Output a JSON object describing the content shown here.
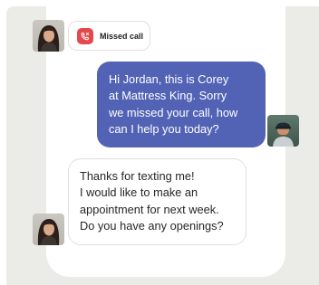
{
  "missed_call": {
    "label": "Missed call",
    "icon": "phone-missed-icon",
    "icon_color": "#e5484d"
  },
  "outgoing_message": {
    "lines": [
      "Hi Jordan, this is Corey",
      "at Mattress King. Sorry",
      "we missed your call, how",
      "can I help you today?"
    ],
    "bubble_color": "#5263b5"
  },
  "incoming_message": {
    "lines": [
      "Thanks for texting me!",
      "I would like to make an",
      "appointment for next week.",
      "Do you have any openings?"
    ]
  },
  "colors": {
    "backdrop": "#ebebe8",
    "card": "#ffffff"
  }
}
